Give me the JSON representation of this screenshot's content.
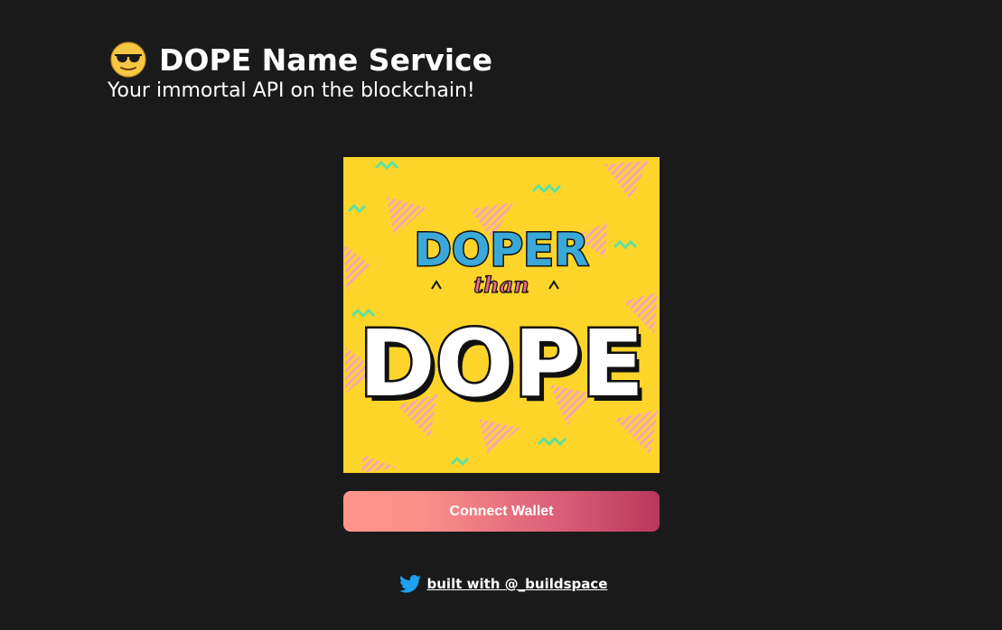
{
  "header": {
    "emoji_icon": "sunglasses-face-icon",
    "title": "DOPE Name Service",
    "subtitle": "Your immortal API on the blockchain!"
  },
  "hero": {
    "line1": "DOPER",
    "line2": "than",
    "line3": "DOPE",
    "colors": {
      "background": "#fdd52a",
      "doper": "#3aa8d8",
      "than": "#f06a8a",
      "dope_fill": "#ffffff",
      "dope_outline": "#111111",
      "triangles": "#f7a6b8",
      "squiggles": "#5ee0a0"
    }
  },
  "connect": {
    "label": "Connect Wallet"
  },
  "footer": {
    "icon": "twitter-icon",
    "link_text": "built with @_buildspace"
  },
  "colors": {
    "page_background": "#1a1a1a",
    "button_gradient_start": "#ff958a",
    "button_gradient_end": "#b8375d",
    "twitter_blue": "#1da1f2"
  }
}
